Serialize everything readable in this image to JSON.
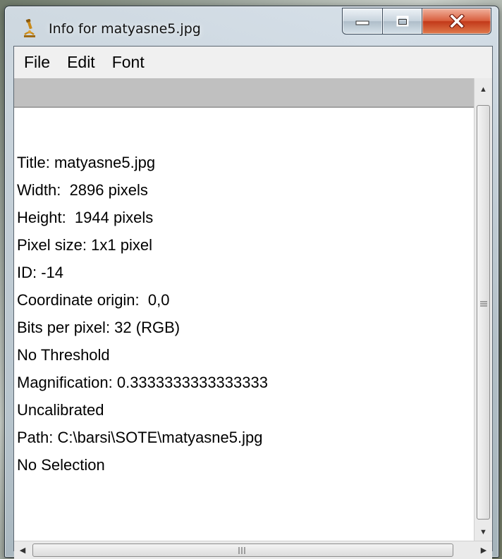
{
  "window": {
    "title": "Info for matyasne5.jpg",
    "app_icon": "microscope-icon"
  },
  "caption_buttons": {
    "minimize_icon": "minimize-icon",
    "maximize_icon": "maximize-icon",
    "close_icon": "close-icon"
  },
  "menu": {
    "items": [
      "File",
      "Edit",
      "Font"
    ]
  },
  "info": {
    "lines": [
      "Title: matyasne5.jpg",
      "Width:  2896 pixels",
      "Height:  1944 pixels",
      "Pixel size: 1x1 pixel",
      "ID: -14",
      "Coordinate origin:  0,0",
      "Bits per pixel: 32 (RGB)",
      "No Threshold",
      "Magnification: 0.3333333333333333",
      "Uncalibrated",
      "Path: C:\\barsi\\SOTE\\matyasne5.jpg",
      "No Selection"
    ]
  },
  "scrollbars": {
    "up_arrow": "scroll-up-arrow-icon",
    "down_arrow": "scroll-down-arrow-icon",
    "left_arrow": "scroll-left-arrow-icon",
    "right_arrow": "scroll-right-arrow-icon"
  },
  "colors": {
    "close_button": "#c7432a",
    "header_strip": "#c0c0c0",
    "text_background": "#ffffff"
  }
}
